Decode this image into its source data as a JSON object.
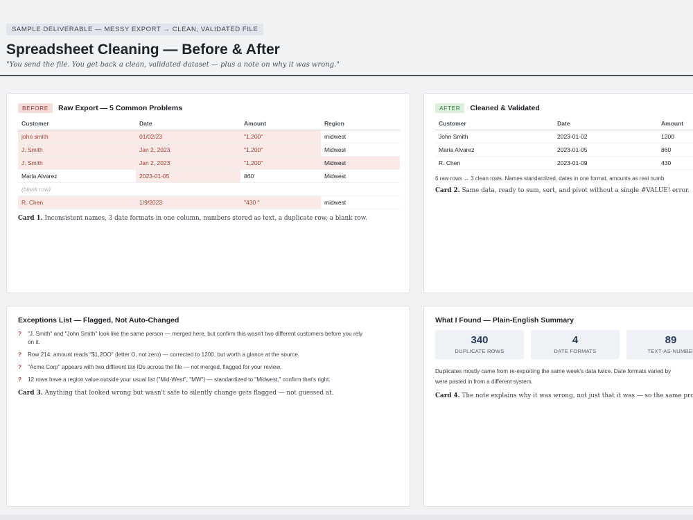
{
  "header": {
    "tag": "SAMPLE DELIVERABLE — MESSY EXPORT → CLEAN, VALIDATED FILE",
    "title": "Spreadsheet Cleaning — Before & After",
    "subtitle": "\"You send the file. You get back a clean, validated dataset — plus a note on why it was wrong.\""
  },
  "before": {
    "badge": "BEFORE",
    "title": "Raw Export — 5 Common Problems",
    "columns": [
      "Customer",
      "Date",
      "Amount",
      "Region"
    ],
    "rows": [
      {
        "customer": "john smith",
        "date": "01/02/23",
        "amount": "\"1,200\"",
        "region": "midwest"
      },
      {
        "customer": "J. Smith",
        "date": "Jan 2, 2023",
        "amount": "\"1,200\"",
        "region": "Midwest"
      },
      {
        "customer": "J. Smith",
        "date": "Jan 2, 2023",
        "amount": "\"1,200\"",
        "region": "Midwest"
      },
      {
        "customer": "Maria Alvarez",
        "date": "2023-01-05",
        "amount": "860",
        "region": "Midwest"
      },
      {
        "customer": "(blank row)",
        "date": "",
        "amount": "",
        "region": ""
      },
      {
        "customer": "R. Chen",
        "date": "1/9/2023",
        "amount": "\"430 \"",
        "region": "midwest"
      }
    ],
    "caption_label": "Card 1.",
    "caption": " Inconsistent names, 3 date formats in one column, numbers stored as text, a duplicate row, a blank row."
  },
  "after": {
    "badge": "AFTER",
    "title": "Cleaned & Validated",
    "columns": [
      "Customer",
      "Date",
      "Amount"
    ],
    "rows": [
      {
        "customer": "John Smith",
        "date": "2023-01-02",
        "amount": "1200"
      },
      {
        "customer": "Maria Alvarez",
        "date": "2023-01-05",
        "amount": "860"
      },
      {
        "customer": "R. Chen",
        "date": "2023-01-09",
        "amount": "430"
      }
    ],
    "note": "6 raw rows → 3 clean rows. Names standardized, dates in one format, amounts as real numb",
    "caption_label": "Card 2.",
    "caption": " Same data, ready to sum, sort, and pivot without a single #VALUE! error."
  },
  "exceptions": {
    "title": "Exceptions List — Flagged, Not Auto-Changed",
    "items": [
      {
        "line1": "\"J. Smith\" and \"John Smith\" look like the same person — merged here, but confirm this wasn't two different customers before you rely",
        "line2": "on it."
      },
      {
        "line1": "Row 214: amount reads \"$1,2OO\" (letter O, not zero) — corrected to 1200, but worth a glance at the source.",
        "line2": ""
      },
      {
        "line1": "\"Acme Corp\" appears with two different tax IDs across the file — not merged, flagged for your review.",
        "line2": ""
      },
      {
        "line1": "12 rows have a region value outside your usual list (\"Mid-West\", \"MW\") — standardized to \"Midwest,\" confirm that's right.",
        "line2": ""
      }
    ],
    "caption_label": "Card 3.",
    "caption": " Anything that looked wrong but wasn't safe to silently change gets flagged — not guessed at."
  },
  "summary": {
    "title": "What I Found — Plain-English Summary",
    "stats": [
      {
        "value": "340",
        "label": "DUPLICATE ROWS"
      },
      {
        "value": "4",
        "label": "DATE FORMATS"
      },
      {
        "value": "89",
        "label": "TEXT-AS-NUMBEI"
      }
    ],
    "para_line1": "Duplicates mostly came from re-exporting the same week's data twice. Date formats varied by",
    "para_line2": "were pasted in from a different system.",
    "caption_label": "Card 4.",
    "caption": " The note explains why it was wrong, not just that it was — so the same proble"
  }
}
